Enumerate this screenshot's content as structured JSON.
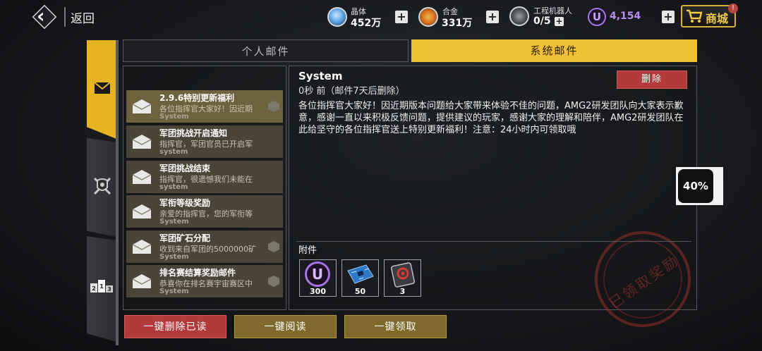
{
  "topbar": {
    "back_label": "返回",
    "resources": [
      {
        "label": "晶体",
        "value": "452万",
        "color": "#62a8e8"
      },
      {
        "label": "合金",
        "value": "331万",
        "color": "#e8932c"
      },
      {
        "label": "工程机器人",
        "value": "0/5"
      }
    ],
    "currency_value": "4,154",
    "currency_symbol": "U",
    "currency_color": "#a773e6",
    "shop_label": "商城",
    "shop_badge": "!"
  },
  "tabs": {
    "personal": "个人邮件",
    "system": "系统邮件"
  },
  "mail_list": [
    {
      "title": "2.9.6特别更新福利",
      "preview": "各位指挥官大家好！因近期",
      "sender": "System",
      "selected": true,
      "has_attachment": true
    },
    {
      "title": "军团挑战开启通知",
      "preview": "指挥官，军团官员已开启军",
      "sender": "system",
      "selected": false,
      "has_attachment": false
    },
    {
      "title": "军团挑战结束",
      "preview": "指挥官，很遗憾我们未能在",
      "sender": "system",
      "selected": false,
      "has_attachment": false
    },
    {
      "title": "军衔等级奖励",
      "preview": "亲爱的指挥官，您的军衔等",
      "sender": "System",
      "selected": false,
      "has_attachment": false
    },
    {
      "title": "军团矿石分配",
      "preview": "收到来自军团的5000000矿",
      "sender": "System",
      "selected": false,
      "has_attachment": true
    },
    {
      "title": "排名赛结算奖励邮件",
      "preview": "恭喜你在排名赛宇宙赛区中",
      "sender": "System",
      "selected": false,
      "has_attachment": true
    }
  ],
  "detail": {
    "sender": "System",
    "time": "0秒 前（邮件7天后删除）",
    "delete_label": "删除",
    "body": "各位指挥官大家好！因近期版本问题给大家带来体验不佳的问题，AMG2研发团队向大家表示歉意，感谢一直以来积极反馈问题，提供建议的玩家，感谢大家的理解和陪伴，AMG2研发团队在此给坚守的各位指挥官送上特别更新福利！注意：24小时内可领取哦",
    "attachments_label": "附件",
    "attachments": [
      {
        "icon": "u-currency-icon",
        "count": "300"
      },
      {
        "icon": "circuit-board-icon",
        "count": "50"
      },
      {
        "icon": "red-chip-icon",
        "count": "3"
      }
    ],
    "stamp_text": "已领取奖励"
  },
  "bottom_buttons": {
    "delete_read": "一键删除已读",
    "read_all": "一键阅读",
    "claim_all": "一键领取"
  },
  "floating_widget": "40%"
}
